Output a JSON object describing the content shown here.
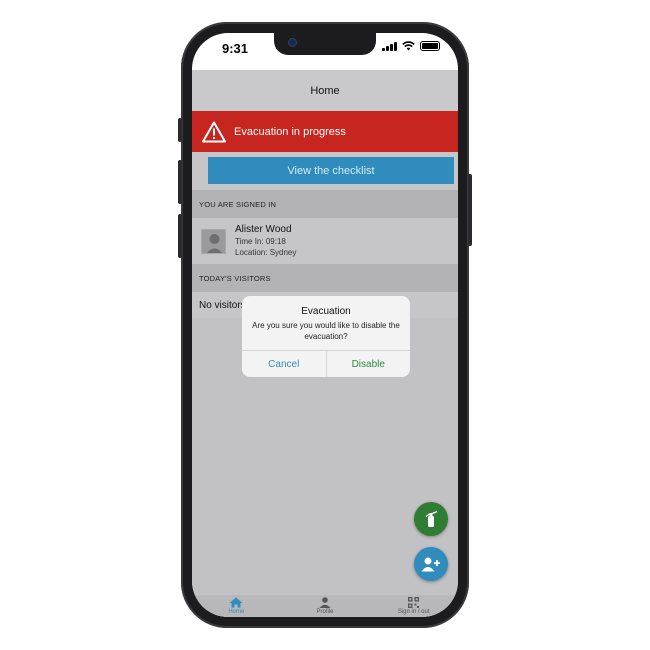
{
  "status_bar": {
    "time": "9:31"
  },
  "header": {
    "title": "Home"
  },
  "alert": {
    "text": "Evacuation in progress",
    "color": "#c6261f"
  },
  "checklist": {
    "label": "View the checklist"
  },
  "signed_in": {
    "section_label": "YOU ARE SIGNED IN",
    "user": {
      "name": "Alister Wood",
      "time_in": "Time In: 09:18",
      "location": "Location: Sydney"
    }
  },
  "visitors": {
    "section_label": "TODAY'S VISITORS",
    "empty_text": "No visitors"
  },
  "dialog": {
    "title": "Evacuation",
    "message": "Are you sure you would like to disable the evacuation?",
    "cancel_label": "Cancel",
    "confirm_label": "Disable"
  },
  "fabs": {
    "extinguisher_icon": "fire-extinguisher-icon",
    "add_visitor_icon": "add-person-icon"
  },
  "tabbar": {
    "items": [
      {
        "label": "Home",
        "icon": "home-icon",
        "active": true
      },
      {
        "label": "Profile",
        "icon": "person-icon",
        "active": false
      },
      {
        "label": "Sign in / out",
        "icon": "qr-code-icon",
        "active": false
      }
    ]
  },
  "colors": {
    "accent_blue": "#2f8cbc",
    "green": "#2e7d32",
    "alert_red": "#c6261f"
  }
}
